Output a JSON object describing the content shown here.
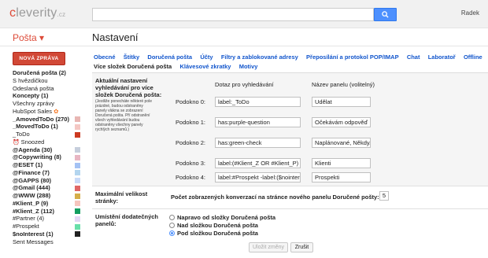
{
  "header": {
    "logo_main": "cleverity",
    "logo_tld": ".cz",
    "search_placeholder": "",
    "user_name": "Radek"
  },
  "app_title": "Pošta ▾",
  "page_title": "Nastavení",
  "sidebar": {
    "compose_label": "NOVÁ ZPRÁVA",
    "items": [
      {
        "label": "Doručená pošta (2)",
        "bold": true,
        "color": ""
      },
      {
        "label": "S hvězdičkou",
        "bold": false,
        "color": ""
      },
      {
        "label": "Odeslaná pošta",
        "bold": false,
        "color": ""
      },
      {
        "label": "Koncepty (1)",
        "bold": true,
        "color": ""
      },
      {
        "label": "Všechny zprávy",
        "bold": false,
        "color": ""
      },
      {
        "label": "HubSpot Sales",
        "bold": false,
        "color": ""
      },
      {
        "label": "_AmovedToDo (270)",
        "bold": true,
        "color": "#e8b6b3"
      },
      {
        "label": "_MovedToDo (1)",
        "bold": true,
        "color": "#f4c7c3"
      },
      {
        "label": "_ToDo",
        "bold": false,
        "color": "#cc3a21"
      },
      {
        "label": "Snoozed",
        "bold": false,
        "color": ""
      },
      {
        "label": "@Agenda (30)",
        "bold": true,
        "color": "#c6cedc"
      },
      {
        "label": "@Copywriting (8)",
        "bold": true,
        "color": "#e8b6c3"
      },
      {
        "label": "@ESET (1)",
        "bold": true,
        "color": "#a4c2f4"
      },
      {
        "label": "@Finance (7)",
        "bold": true,
        "color": "#b3d5ef"
      },
      {
        "label": "@GAPPS (80)",
        "bold": true,
        "color": "#c9daf8"
      },
      {
        "label": "@Gmail (444)",
        "bold": true,
        "color": "#e06666"
      },
      {
        "label": "@WWW (288)",
        "bold": true,
        "color": "#d5ae49"
      },
      {
        "label": "#Klient_P (9)",
        "bold": true,
        "color": "#f6c5be"
      },
      {
        "label": "#Klient_Z (112)",
        "bold": true,
        "color": "#149e60"
      },
      {
        "label": "#Partner (4)",
        "bold": false,
        "color": "#e4d7f5"
      },
      {
        "label": "#Prospekt",
        "bold": false,
        "color": "#68dfa9"
      },
      {
        "label": "$noInterest (1)",
        "bold": true,
        "color": "#222222"
      },
      {
        "label": "Sent Messages",
        "bold": false,
        "color": ""
      }
    ]
  },
  "tabs": {
    "row1": [
      "Obecné",
      "Štítky",
      "Doručená pošta",
      "Účty",
      "Filtry a zablokované adresy",
      "Přeposílání a protokol POP/IMAP",
      "Chat",
      "Laboratoř",
      "Offline"
    ],
    "row2": [
      "Více složek Doručená pošta",
      "Klávesové zkratky",
      "Motivy"
    ]
  },
  "multi_inbox": {
    "title": "Aktuální nastavení vyhledávání pro více složek Doručená pošta:",
    "note": "(Jestliže ponecháte některé pole prázdné, budou odstraněny panely vlákna se zobrazení Doručená pošta. Pří odstranění všech vyhledávání budou odstraněny všechny panely rychlých seznamů.)",
    "col_query": "Dotaz pro vyhledávání",
    "col_name": "Název panelu (volitelný)",
    "panes": [
      {
        "label": "Podokno 0:",
        "query": "label:_ToDo",
        "name": "Udělat"
      },
      {
        "label": "Podokno 1:",
        "query": "has:purple-question",
        "name": "Očekávám odpověď"
      },
      {
        "label": "Podokno 2:",
        "query": "has:green-check",
        "name": "Naplánované, Někdy/Možná"
      },
      {
        "label": "Podokno 3:",
        "query": "label:(#Klient_Z OR #Klient_P) -l",
        "name": "Klienti"
      },
      {
        "label": "Podokno 4:",
        "query": "label:#Prospekt -label:($nointerest",
        "name": "Prospekti"
      }
    ]
  },
  "max_size": {
    "title": "Maximální velikost stránky:",
    "question": "Počet zobrazených konverzací na stránce nového panelu Doručené pošty:",
    "value": "5"
  },
  "position": {
    "title": "Umístění dodatečných panelů:",
    "options": [
      {
        "label": "Napravo od složky Doručená pošta",
        "selected": false
      },
      {
        "label": "Nad složkou Doručená pošta",
        "selected": false
      },
      {
        "label": "Pod složkou Doručená pošta",
        "selected": true
      }
    ]
  },
  "buttons": {
    "save": "Uložit změny",
    "cancel": "Zrušit"
  },
  "colors": {
    "accent_red": "#dd4b39",
    "link_blue": "#1155cc",
    "search_blue": "#4d90fe"
  }
}
